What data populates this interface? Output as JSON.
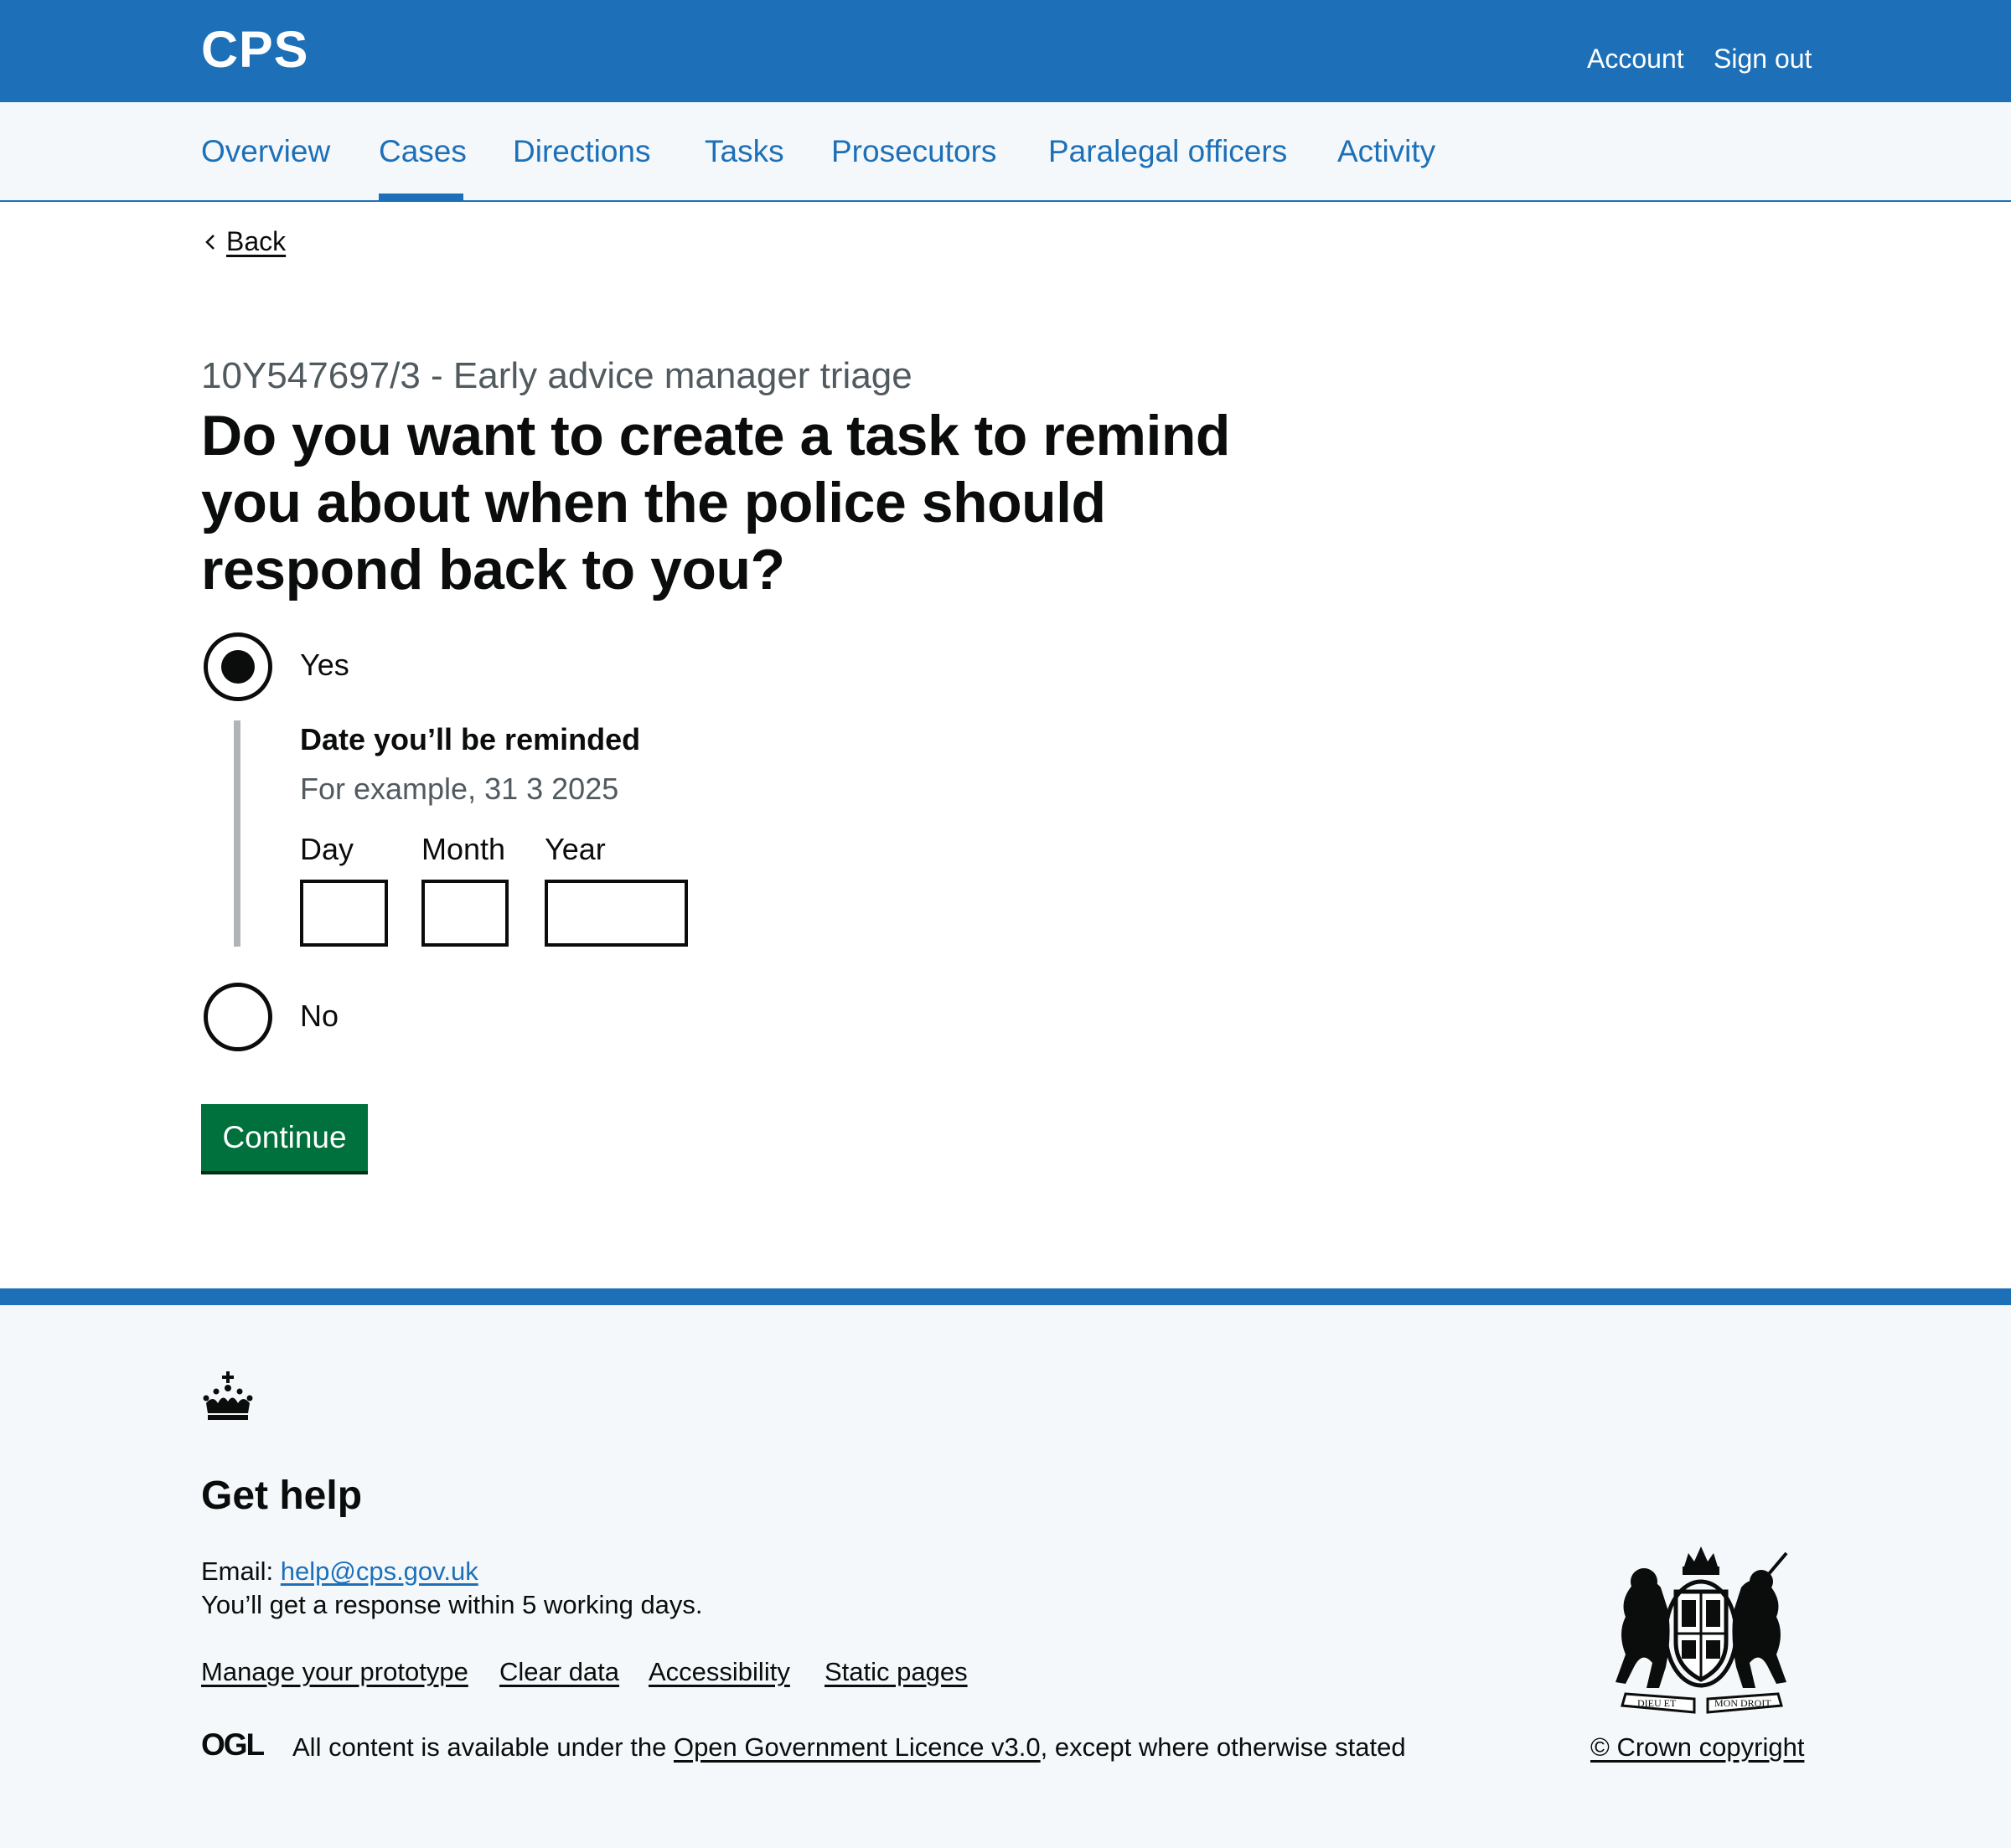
{
  "header": {
    "logo": "CPS",
    "account_label": "Account",
    "signout_label": "Sign out",
    "brand_color": "#1d70b8"
  },
  "nav": {
    "items": [
      {
        "label": "Overview"
      },
      {
        "label": "Cases",
        "current": true
      },
      {
        "label": "Directions"
      },
      {
        "label": "Tasks"
      },
      {
        "label": "Prosecutors"
      },
      {
        "label": "Paralegal officers"
      },
      {
        "label": "Activity"
      }
    ]
  },
  "back_label": "Back",
  "form": {
    "caption": "10Y547697/3 - Early advice manager triage",
    "question": "Do you want to create a task to remind you about when the police should respond back to you?",
    "options": [
      {
        "label": "Yes",
        "selected": true
      },
      {
        "label": "No",
        "selected": false
      }
    ],
    "date": {
      "legend": "Date you’ll be reminded",
      "hint": "For example, 31 3 2025",
      "day_label": "Day",
      "month_label": "Month",
      "year_label": "Year",
      "day_value": "",
      "month_value": "",
      "year_value": ""
    },
    "continue_label": "Continue",
    "continue_color": "#00703c"
  },
  "footer": {
    "get_help": "Get help",
    "email_prefix": "Email: ",
    "email": "help@cps.gov.uk",
    "response": "You’ll get a response within 5 working days.",
    "links": [
      "Manage your prototype",
      "Clear data",
      "Accessibility",
      "Static pages"
    ],
    "ogl_logo": "OGL",
    "licence_prefix": "All content is available under the ",
    "licence_link": "Open Government Licence v3.0",
    "licence_suffix": ", except where otherwise stated",
    "copyright": "© Crown copyright",
    "coat_motto_left": "DIEU ET",
    "coat_motto_right": "MON DROIT",
    "coat_icon": "royal-coat-of-arms"
  }
}
